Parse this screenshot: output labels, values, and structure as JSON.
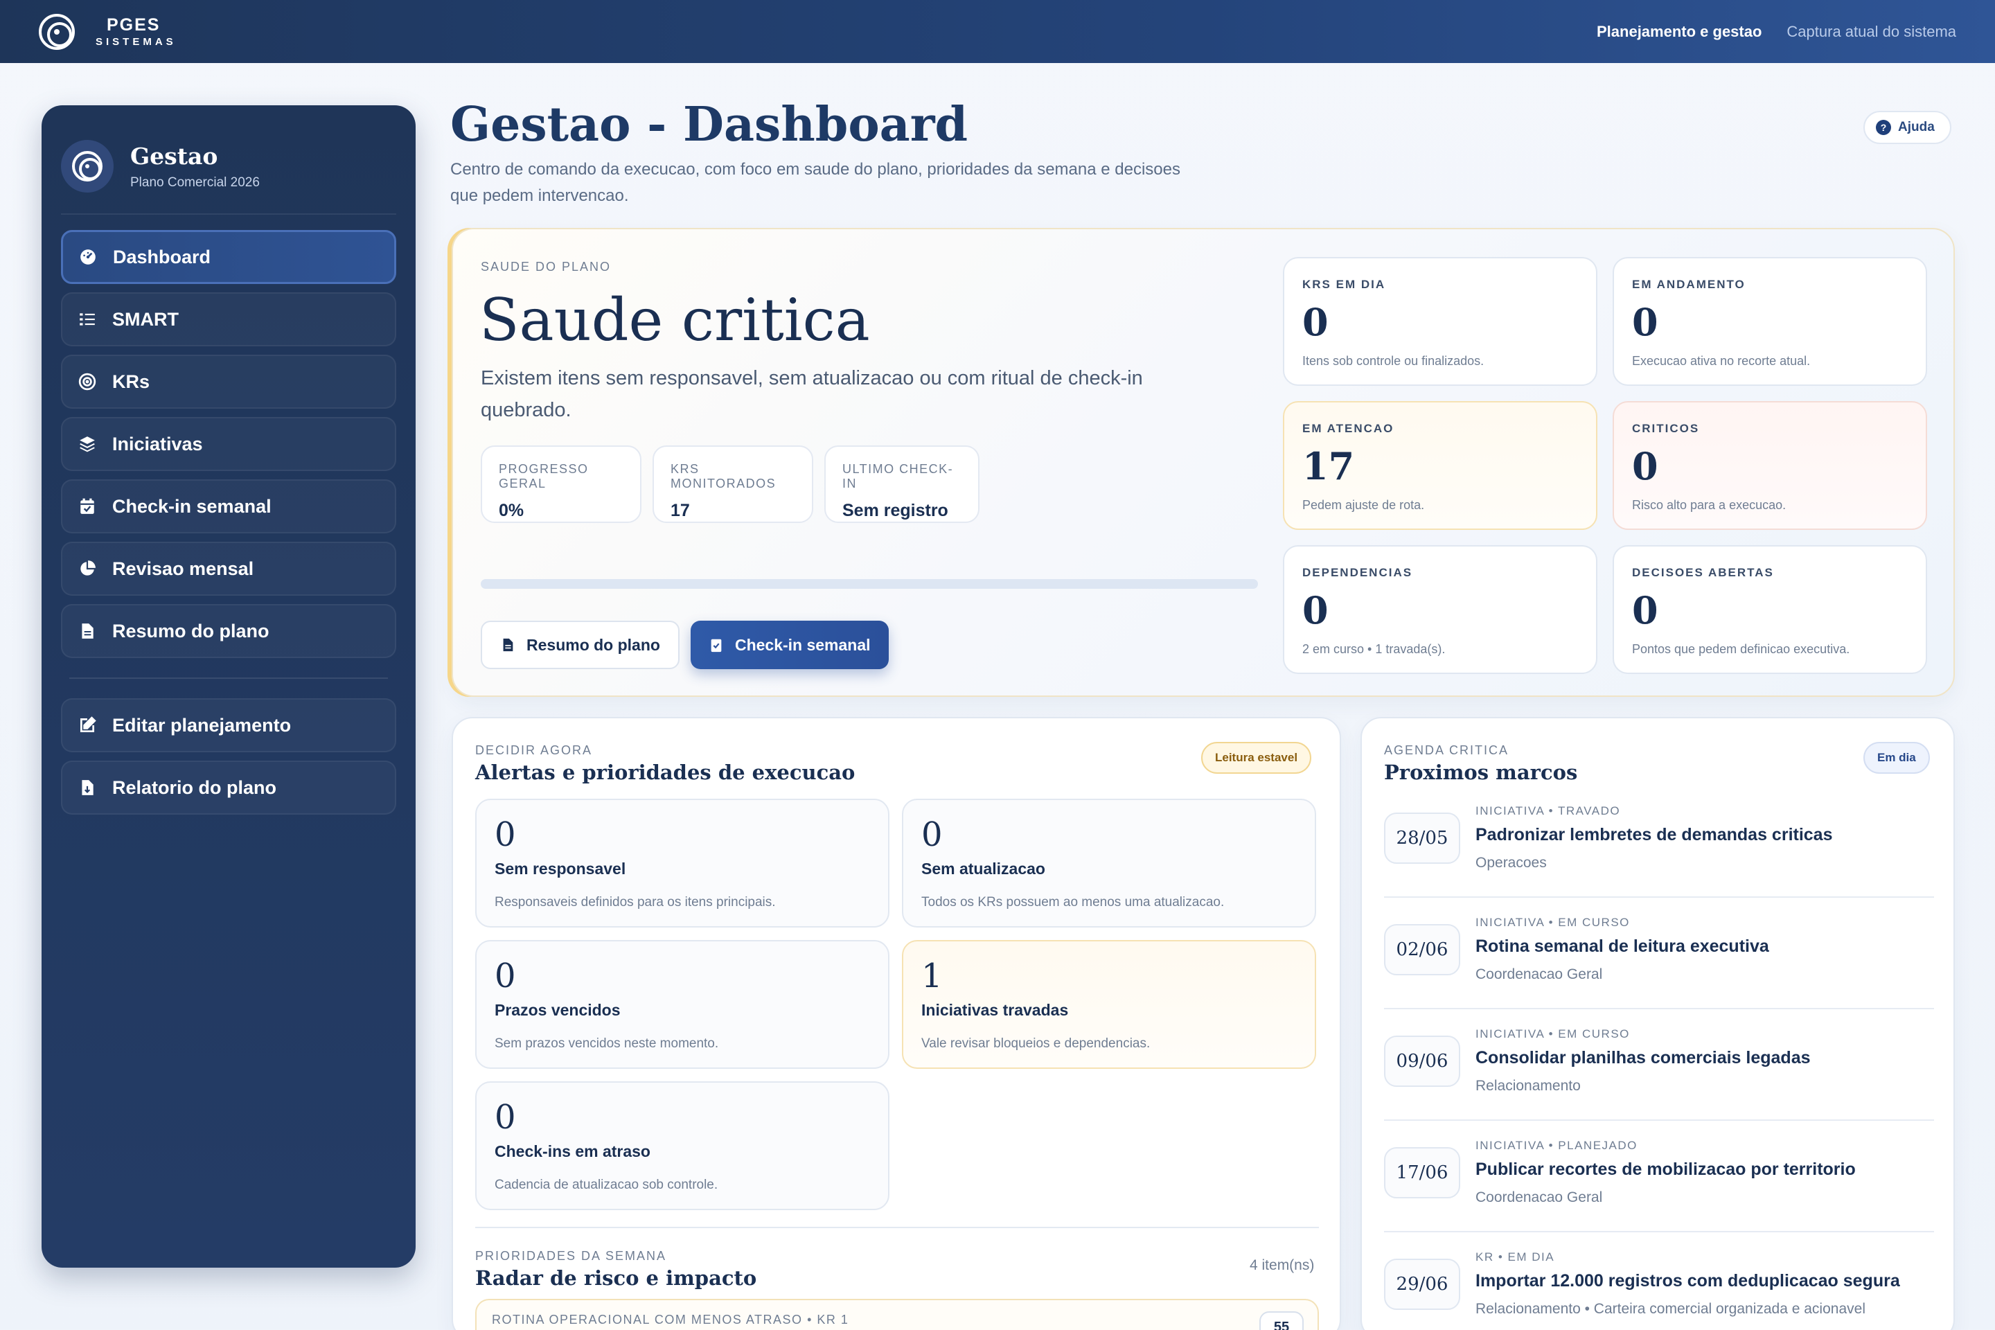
{
  "topbar": {
    "brand_name": "PGES",
    "brand_sub": "SISTEMAS",
    "links": [
      "Planejamento e gestao",
      "Captura atual do sistema"
    ]
  },
  "sidebar": {
    "title": "Gestao",
    "subtitle": "Plano Comercial 2026",
    "items": [
      {
        "label": "Dashboard",
        "icon": "dashboard-icon",
        "active": true
      },
      {
        "label": "SMART",
        "icon": "list-icon"
      },
      {
        "label": "KRs",
        "icon": "target-icon"
      },
      {
        "label": "Iniciativas",
        "icon": "layers-icon"
      },
      {
        "label": "Check-in semanal",
        "icon": "calendar-check-icon"
      },
      {
        "label": "Revisao mensal",
        "icon": "pie-chart-icon"
      },
      {
        "label": "Resumo do plano",
        "icon": "document-icon"
      }
    ],
    "secondary": [
      {
        "label": "Editar planejamento",
        "icon": "edit-icon"
      },
      {
        "label": "Relatorio do plano",
        "icon": "report-icon"
      }
    ]
  },
  "header": {
    "title": "Gestao - Dashboard",
    "description": "Centro de comando da execucao, com foco em saude do plano, prioridades da semana e decisoes que pedem intervencao.",
    "help_label": "Ajuda"
  },
  "hero": {
    "eyebrow": "SAUDE DO PLANO",
    "title": "Saude critica",
    "text": "Existem itens sem responsavel, sem atualizacao ou com ritual de check-in quebrado.",
    "mini": [
      {
        "label": "PROGRESSO GERAL",
        "value": "0%"
      },
      {
        "label": "KRS MONITORADOS",
        "value": "17"
      },
      {
        "label": "ULTIMO CHECK-IN",
        "value": "Sem registro"
      }
    ],
    "progress": 0,
    "buttons": {
      "summary": "Resumo do plano",
      "checkin": "Check-in semanal"
    },
    "stats": [
      {
        "label": "KRS EM DIA",
        "value": "0",
        "note": "Itens sob controle ou finalizados.",
        "tone": "normal"
      },
      {
        "label": "EM ANDAMENTO",
        "value": "0",
        "note": "Execucao ativa no recorte atual.",
        "tone": "normal"
      },
      {
        "label": "EM ATENCAO",
        "value": "17",
        "note": "Pedem ajuste de rota.",
        "tone": "warn"
      },
      {
        "label": "CRITICOS",
        "value": "0",
        "note": "Risco alto para a execucao.",
        "tone": "crit"
      },
      {
        "label": "DEPENDENCIAS",
        "value": "0",
        "note": "2 em curso • 1 travada(s).",
        "tone": "normal"
      },
      {
        "label": "DECISOES ABERTAS",
        "value": "0",
        "note": "Pontos que pedem definicao executiva.",
        "tone": "normal"
      }
    ]
  },
  "alerts": {
    "eyebrow": "DECIDIR AGORA",
    "title": "Alertas e prioridades de execucao",
    "badge": "Leitura estavel",
    "cards": [
      {
        "value": "0",
        "title": "Sem responsavel",
        "note": "Responsaveis definidos para os itens principais.",
        "tone": "normal"
      },
      {
        "value": "0",
        "title": "Sem atualizacao",
        "note": "Todos os KRs possuem ao menos uma atualizacao.",
        "tone": "normal"
      },
      {
        "value": "0",
        "title": "Prazos vencidos",
        "note": "Sem prazos vencidos neste momento.",
        "tone": "normal"
      },
      {
        "value": "1",
        "title": "Iniciativas travadas",
        "note": "Vale revisar bloqueios e dependencias.",
        "tone": "warn"
      },
      {
        "value": "0",
        "title": "Check-ins em atraso",
        "note": "Cadencia de atualizacao sob controle.",
        "tone": "normal"
      }
    ],
    "radar": {
      "eyebrow": "PRIORIDADES DA SEMANA",
      "title": "Radar de risco e impacto",
      "count": "4 item(ns)",
      "first_row_label": "ROTINA OPERACIONAL COM MENOS ATRASO • KR 1",
      "first_row_score": "55"
    }
  },
  "milestones": {
    "eyebrow": "AGENDA CRITICA",
    "title": "Proximos marcos",
    "badge": "Em dia",
    "items": [
      {
        "date": "28/05",
        "tag": "INICIATIVA • TRAVADO",
        "title": "Padronizar lembretes de demandas criticas",
        "sub": "Operacoes"
      },
      {
        "date": "02/06",
        "tag": "INICIATIVA • EM CURSO",
        "title": "Rotina semanal de leitura executiva",
        "sub": "Coordenacao Geral"
      },
      {
        "date": "09/06",
        "tag": "INICIATIVA • EM CURSO",
        "title": "Consolidar planilhas comerciais legadas",
        "sub": "Relacionamento"
      },
      {
        "date": "17/06",
        "tag": "INICIATIVA • PLANEJADO",
        "title": "Publicar recortes de mobilizacao por territorio",
        "sub": "Coordenacao Geral"
      },
      {
        "date": "29/06",
        "tag": "KR • EM DIA",
        "title": "Importar 12.000 registros com deduplicacao segura",
        "sub": "Relacionamento • Carteira comercial organizada e acionavel"
      }
    ]
  }
}
